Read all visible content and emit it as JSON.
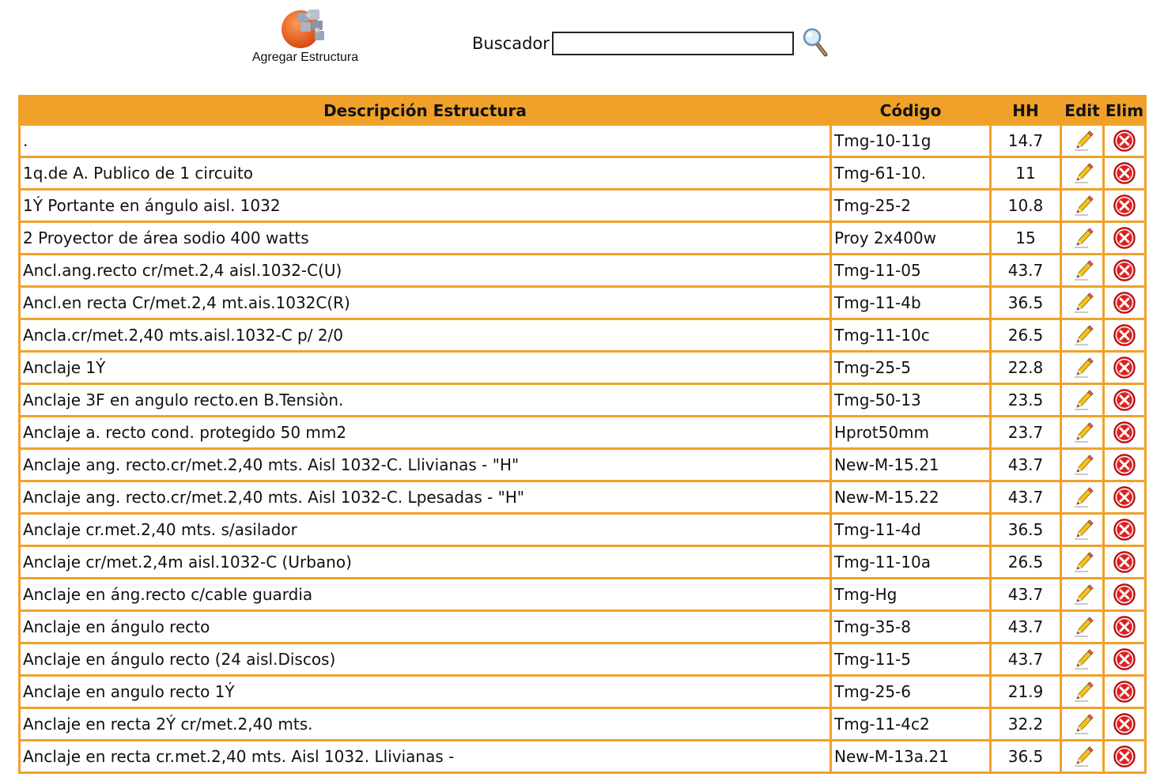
{
  "toolbar": {
    "add_label": "Agregar Estructura",
    "add_icon": "puzzle-icon",
    "search_label": "Buscador",
    "search_value": "",
    "search_icon": "magnifier-icon"
  },
  "colors": {
    "accent": "#f0a12a",
    "delete": "#e02020",
    "logo": "#e8612a"
  },
  "table": {
    "headers": {
      "description": "Descripción Estructura",
      "code": "Código",
      "hh": "HH",
      "edit": "Edit",
      "delete": "Elim"
    },
    "edit_icon": "pencil-icon",
    "delete_icon": "delete-icon",
    "rows": [
      {
        "description": ".",
        "code": "Tmg-10-11g",
        "hh": "14.7"
      },
      {
        "description": "1q.de A. Publico de 1 circuito",
        "code": "Tmg-61-10.",
        "hh": "11"
      },
      {
        "description": "1Ý Portante en ángulo aisl. 1032",
        "code": "Tmg-25-2",
        "hh": "10.8"
      },
      {
        "description": "2 Proyector de área sodio 400 watts",
        "code": "Proy 2x400w",
        "hh": "15"
      },
      {
        "description": "Ancl.ang.recto cr/met.2,4 aisl.1032-C(U)",
        "code": "Tmg-11-05",
        "hh": "43.7"
      },
      {
        "description": "Ancl.en recta Cr/met.2,4 mt.ais.1032C(R)",
        "code": "Tmg-11-4b",
        "hh": "36.5"
      },
      {
        "description": "Ancla.cr/met.2,40 mts.aisl.1032-C p/ 2/0",
        "code": "Tmg-11-10c",
        "hh": "26.5"
      },
      {
        "description": "Anclaje 1Ý",
        "code": "Tmg-25-5",
        "hh": "22.8"
      },
      {
        "description": "Anclaje 3F en angulo recto.en B.Tensiòn.",
        "code": "Tmg-50-13",
        "hh": "23.5"
      },
      {
        "description": "Anclaje a. recto cond. protegido 50 mm2",
        "code": "Hprot50mm",
        "hh": "23.7"
      },
      {
        "description": "Anclaje ang. recto.cr/met.2,40 mts. Aisl 1032-C. Llivianas - \"H\"",
        "code": "New-M-15.21",
        "hh": "43.7"
      },
      {
        "description": "Anclaje ang. recto.cr/met.2,40 mts. Aisl 1032-C. Lpesadas - \"H\"",
        "code": "New-M-15.22",
        "hh": "43.7"
      },
      {
        "description": "Anclaje cr.met.2,40 mts. s/asilador",
        "code": "Tmg-11-4d",
        "hh": "36.5"
      },
      {
        "description": "Anclaje cr/met.2,4m aisl.1032-C (Urbano)",
        "code": "Tmg-11-10a",
        "hh": "26.5"
      },
      {
        "description": "Anclaje en áng.recto c/cable guardia",
        "code": "Tmg-Hg",
        "hh": "43.7"
      },
      {
        "description": "Anclaje en ángulo recto",
        "code": "Tmg-35-8",
        "hh": "43.7"
      },
      {
        "description": "Anclaje en ángulo recto (24 aisl.Discos)",
        "code": "Tmg-11-5",
        "hh": "43.7"
      },
      {
        "description": "Anclaje en angulo recto 1Ý",
        "code": "Tmg-25-6",
        "hh": "21.9"
      },
      {
        "description": "Anclaje en recta 2Ý cr/met.2,40 mts.",
        "code": "Tmg-11-4c2",
        "hh": "32.2"
      },
      {
        "description": "Anclaje en recta cr.met.2,40 mts. Aisl 1032. Llivianas -",
        "code": "New-M-13a.21",
        "hh": "36.5"
      }
    ]
  }
}
